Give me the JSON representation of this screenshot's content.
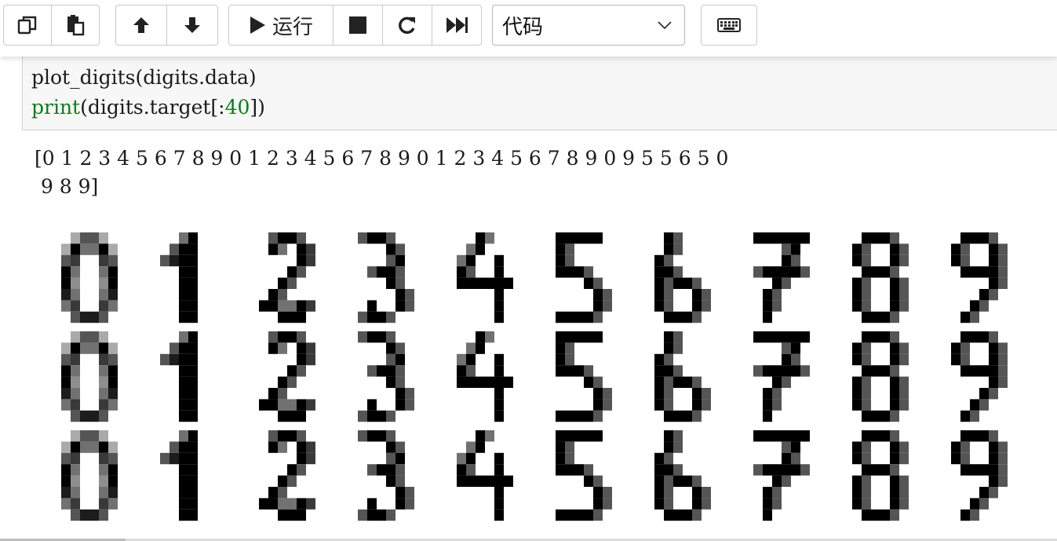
{
  "toolbar": {
    "run_label": "运行",
    "cell_type": "代码",
    "icons": [
      "copy-icon",
      "paste-icon",
      "move-up-icon",
      "move-down-icon",
      "run-icon",
      "stop-icon",
      "restart-icon",
      "fast-forward-icon",
      "chevron-down-icon",
      "keyboard-icon"
    ]
  },
  "cell": {
    "line1": "plot_digits(digits.data)",
    "line2_fn": "print",
    "line2_a": "(digits.target[:",
    "line2_num": "40",
    "line2_b": "])"
  },
  "output": {
    "line1": "[0 1 2 3 4 5 6 7 8 9 0 1 2 3 4 5 6 7 8 9 0 1 2 3 4 5 6 7 8 9 0 9 5 5 6 5 0",
    "line2": " 9 8 9]"
  },
  "figure": {
    "rows": [
      [
        0,
        1,
        2,
        3,
        4,
        5,
        6,
        7,
        8,
        9
      ],
      [
        0,
        1,
        2,
        3,
        4,
        5,
        6,
        7,
        8,
        9
      ],
      [
        0,
        1,
        2,
        3,
        4,
        5,
        6,
        7,
        8,
        9
      ]
    ]
  }
}
